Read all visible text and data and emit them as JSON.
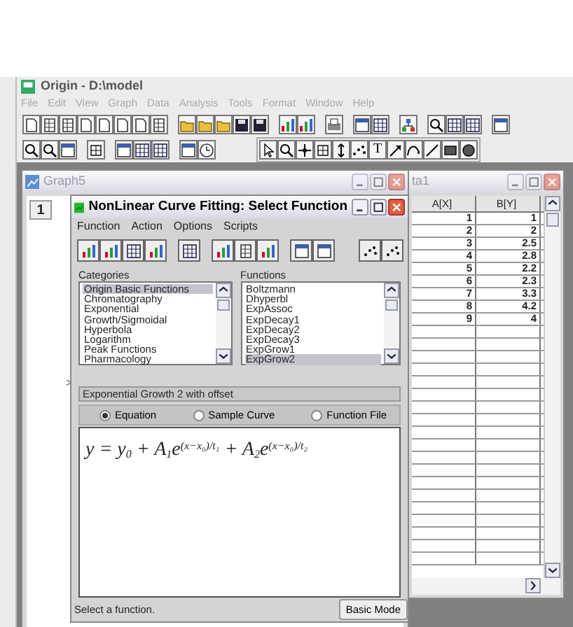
{
  "app": {
    "title": "Origin - D:\\model",
    "menu": [
      "File",
      "Edit",
      "View",
      "Graph",
      "Data",
      "Analysis",
      "Tools",
      "Format",
      "Window",
      "Help"
    ],
    "text_tool": "T"
  },
  "graph_window": {
    "title": "Graph5",
    "layer": "1",
    "edge_mark": ">"
  },
  "data_window": {
    "title": "ta1",
    "columns": [
      "A[X]",
      "B[Y]"
    ],
    "rows": [
      [
        "1",
        "1"
      ],
      [
        "2",
        "2"
      ],
      [
        "3",
        "2.5"
      ],
      [
        "4",
        "2.8"
      ],
      [
        "5",
        "2.2"
      ],
      [
        "6",
        "2.3"
      ],
      [
        "7",
        "3.3"
      ],
      [
        "8",
        "4.2"
      ],
      [
        "9",
        "4"
      ]
    ]
  },
  "dialog": {
    "title": "NonLinear Curve Fitting:  Select Function",
    "menu": [
      "Function",
      "Action",
      "Options",
      "Scripts"
    ],
    "categories_label": "Categories",
    "categories": [
      {
        "label": "Origin Basic Functions",
        "selected": true
      },
      {
        "label": "Chromatography",
        "selected": false
      },
      {
        "label": "Exponential",
        "selected": false
      },
      {
        "label": "Growth/Sigmoidal",
        "selected": false
      },
      {
        "label": "Hyperbola",
        "selected": false
      },
      {
        "label": "Logarithm",
        "selected": false
      },
      {
        "label": "Peak Functions",
        "selected": false
      },
      {
        "label": "Pharmacology",
        "selected": false
      }
    ],
    "functions_label": "Functions",
    "functions": [
      {
        "label": "Boltzmann",
        "selected": false
      },
      {
        "label": "Dhyperbl",
        "selected": false
      },
      {
        "label": "ExpAssoc",
        "selected": false
      },
      {
        "label": "ExpDecay1",
        "selected": false
      },
      {
        "label": "ExpDecay2",
        "selected": false
      },
      {
        "label": "ExpDecay3",
        "selected": false
      },
      {
        "label": "ExpGrow1",
        "selected": false
      },
      {
        "label": "ExpGrow2",
        "selected": true
      }
    ],
    "description": "Exponential Growth 2 with offset",
    "view_options": [
      {
        "label": "Equation",
        "selected": true
      },
      {
        "label": "Sample Curve",
        "selected": false
      },
      {
        "label": "Function File",
        "selected": false
      }
    ],
    "equation": "y = y$_{0}$ + A$_{1}$e$^{(x−x₀)/t₁}$ + A$_{2}$e$^{(x−x₀)/t₂}$",
    "status": "Select a function.",
    "mode_button": "Basic Mode"
  }
}
